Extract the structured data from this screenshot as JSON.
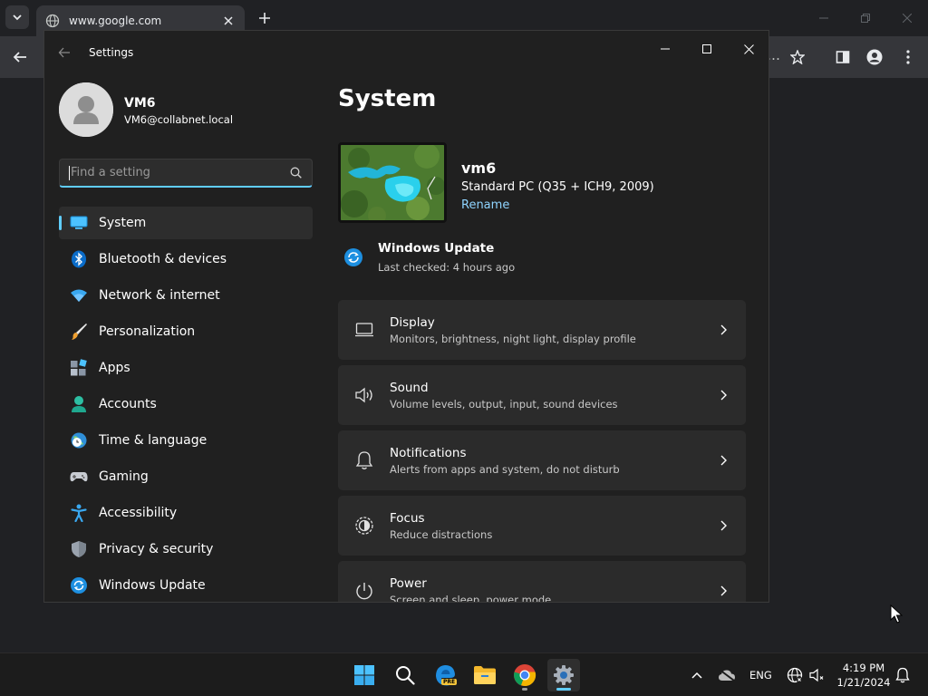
{
  "browser": {
    "tab_title": "www.google.com",
    "ellipsis": "…"
  },
  "settings_window": {
    "title": "Settings",
    "profile": {
      "name": "VM6",
      "email": "VM6@collabnet.local"
    },
    "search": {
      "placeholder": "Find a setting"
    },
    "nav": [
      {
        "label": "System",
        "icon": "system-icon",
        "active": true
      },
      {
        "label": "Bluetooth & devices",
        "icon": "bluetooth-icon"
      },
      {
        "label": "Network & internet",
        "icon": "wifi-icon"
      },
      {
        "label": "Personalization",
        "icon": "brush-icon"
      },
      {
        "label": "Apps",
        "icon": "apps-icon"
      },
      {
        "label": "Accounts",
        "icon": "accounts-icon"
      },
      {
        "label": "Time & language",
        "icon": "globe-clock-icon"
      },
      {
        "label": "Gaming",
        "icon": "gamepad-icon"
      },
      {
        "label": "Accessibility",
        "icon": "accessibility-icon"
      },
      {
        "label": "Privacy & security",
        "icon": "shield-icon"
      },
      {
        "label": "Windows Update",
        "icon": "windows-update-icon"
      }
    ],
    "main": {
      "title": "System",
      "device": {
        "name": "vm6",
        "model": "Standard PC (Q35 + ICH9, 2009)",
        "rename_label": "Rename"
      },
      "windows_update": {
        "title": "Windows Update",
        "subtitle": "Last checked: 4 hours ago"
      },
      "cards": [
        {
          "title": "Display",
          "subtitle": "Monitors, brightness, night light, display profile",
          "icon": "display-icon"
        },
        {
          "title": "Sound",
          "subtitle": "Volume levels, output, input, sound devices",
          "icon": "speaker-icon"
        },
        {
          "title": "Notifications",
          "subtitle": "Alerts from apps and system, do not disturb",
          "icon": "bell-icon"
        },
        {
          "title": "Focus",
          "subtitle": "Reduce distractions",
          "icon": "focus-icon"
        },
        {
          "title": "Power",
          "subtitle": "Screen and sleep, power mode",
          "icon": "power-icon"
        }
      ]
    }
  },
  "taskbar": {
    "language": "ENG",
    "time": "4:19 PM",
    "date": "1/21/2024",
    "edge_badge": "PRE"
  },
  "colors": {
    "accent": "#60cdff",
    "window_bg": "#202020",
    "card_bg": "#2b2b2b",
    "link": "#8fd4ff"
  }
}
